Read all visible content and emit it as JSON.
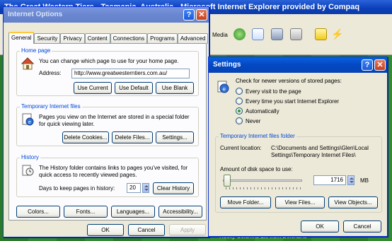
{
  "browser": {
    "title": "The Great Western Tiers - Tasmania, Australia - Microsoft Internet Explorer provided by Compaq",
    "toolbar_media_label": "Media",
    "page_footer_text": "Rocky Columns Lie from Deloraine"
  },
  "internet_options": {
    "title": "Internet Options",
    "tabs": [
      "General",
      "Security",
      "Privacy",
      "Content",
      "Connections",
      "Programs",
      "Advanced"
    ],
    "home_page": {
      "group_label": "Home page",
      "description": "You can change which page to use for your home page.",
      "address_label": "Address:",
      "address_value": "http://www.greatwesterntiers.com.au/",
      "use_current": "Use Current",
      "use_default": "Use Default",
      "use_blank": "Use Blank"
    },
    "temp_files": {
      "group_label": "Temporary Internet files",
      "description_line1": "Pages you view on the Internet are stored in a special folder",
      "description_line2": "for quick viewing later.",
      "delete_cookies": "Delete Cookies...",
      "delete_files": "Delete Files...",
      "settings": "Settings..."
    },
    "history": {
      "group_label": "History",
      "description_line1": "The History folder contains links to pages you've visited, for",
      "description_line2": "quick access to recently viewed pages.",
      "days_label": "Days to keep pages in history:",
      "days_value": "20",
      "clear_history": "Clear History"
    },
    "bottom_buttons": {
      "colors": "Colors...",
      "fonts": "Fonts...",
      "languages": "Languages...",
      "accessibility": "Accessibility..."
    },
    "ok": "OK",
    "cancel": "Cancel",
    "apply": "Apply"
  },
  "settings": {
    "title": "Settings",
    "check_label": "Check for newer versions of stored pages:",
    "options": [
      {
        "label": "Every visit to the page",
        "selected": false
      },
      {
        "label": "Every time you start Internet Explorer",
        "selected": false
      },
      {
        "label": "Automatically",
        "selected": true
      },
      {
        "label": "Never",
        "selected": false
      }
    ],
    "folder_group_label": "Temporary Internet files folder",
    "current_location_label": "Current location:",
    "current_location_line1": "C:\\Documents and Settings\\Glen\\Local",
    "current_location_line2": "Settings\\Temporary Internet Files\\",
    "disk_space_label": "Amount of disk space to use:",
    "disk_space_value": "1716",
    "disk_space_unit": "MB",
    "move_folder": "Move Folder...",
    "view_files": "View Files...",
    "view_objects": "View Objects...",
    "ok": "OK",
    "cancel": "Cancel"
  },
  "colors": {
    "xp_title_blue": "#0448c2",
    "dialog_face": "#ece9d8",
    "group_label_blue": "#0046d5",
    "tab_highlight": "#ffc83c",
    "page_green": "#2f7a2b"
  }
}
